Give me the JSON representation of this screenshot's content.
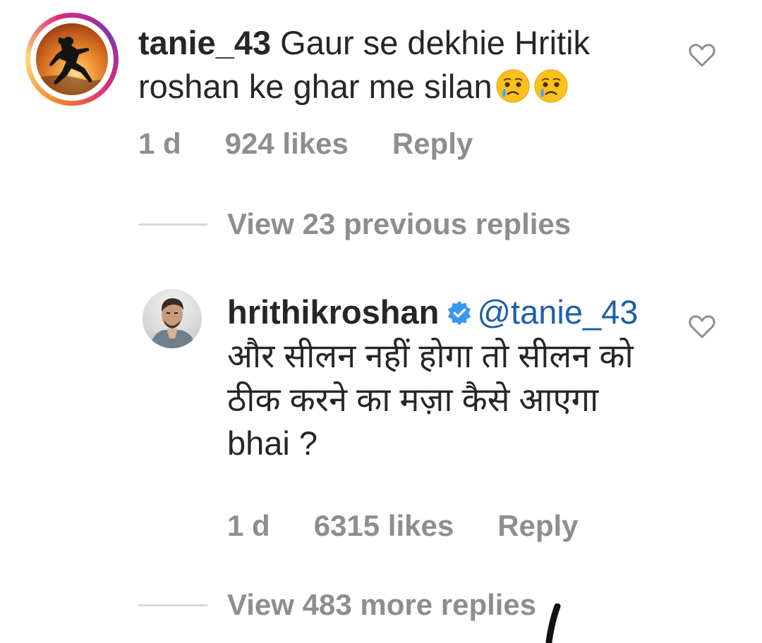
{
  "comment": {
    "username": "tanie_43",
    "text": " Gaur se dekhie Hritik roshan ke ghar me silan",
    "emoji": [
      "crying-face",
      "crying-face"
    ],
    "time": "1 d",
    "likes": "924 likes",
    "reply_label": "Reply"
  },
  "previous_replies_label": "View 23 previous replies",
  "reply": {
    "username": "hrithikroshan",
    "mention": "@tanie_43",
    "text": " और सीलन नहीं होगा तो सीलन को ठीक करने का मज़ा कैसे आएगा bhai ?",
    "time": "1 d",
    "likes": "6315 likes",
    "reply_label": "Reply"
  },
  "more_replies_label": "View 483 more replies",
  "colors": {
    "text": "#262626",
    "meta": "#8e8e8e",
    "mention": "#1f5fa8",
    "verified": "#3897f0"
  }
}
